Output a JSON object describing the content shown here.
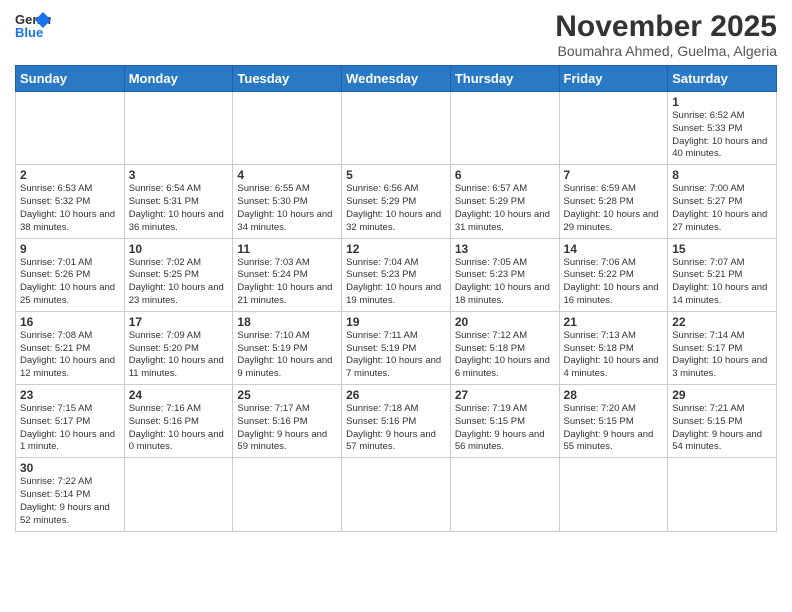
{
  "logo": {
    "text_general": "General",
    "text_blue": "Blue"
  },
  "title": "November 2025",
  "subtitle": "Boumahra Ahmed, Guelma, Algeria",
  "days_of_week": [
    "Sunday",
    "Monday",
    "Tuesday",
    "Wednesday",
    "Thursday",
    "Friday",
    "Saturday"
  ],
  "weeks": [
    [
      {
        "day": "",
        "info": ""
      },
      {
        "day": "",
        "info": ""
      },
      {
        "day": "",
        "info": ""
      },
      {
        "day": "",
        "info": ""
      },
      {
        "day": "",
        "info": ""
      },
      {
        "day": "",
        "info": ""
      },
      {
        "day": "1",
        "info": "Sunrise: 6:52 AM\nSunset: 5:33 PM\nDaylight: 10 hours and 40 minutes."
      }
    ],
    [
      {
        "day": "2",
        "info": "Sunrise: 6:53 AM\nSunset: 5:32 PM\nDaylight: 10 hours and 38 minutes."
      },
      {
        "day": "3",
        "info": "Sunrise: 6:54 AM\nSunset: 5:31 PM\nDaylight: 10 hours and 36 minutes."
      },
      {
        "day": "4",
        "info": "Sunrise: 6:55 AM\nSunset: 5:30 PM\nDaylight: 10 hours and 34 minutes."
      },
      {
        "day": "5",
        "info": "Sunrise: 6:56 AM\nSunset: 5:29 PM\nDaylight: 10 hours and 32 minutes."
      },
      {
        "day": "6",
        "info": "Sunrise: 6:57 AM\nSunset: 5:29 PM\nDaylight: 10 hours and 31 minutes."
      },
      {
        "day": "7",
        "info": "Sunrise: 6:59 AM\nSunset: 5:28 PM\nDaylight: 10 hours and 29 minutes."
      },
      {
        "day": "8",
        "info": "Sunrise: 7:00 AM\nSunset: 5:27 PM\nDaylight: 10 hours and 27 minutes."
      }
    ],
    [
      {
        "day": "9",
        "info": "Sunrise: 7:01 AM\nSunset: 5:26 PM\nDaylight: 10 hours and 25 minutes."
      },
      {
        "day": "10",
        "info": "Sunrise: 7:02 AM\nSunset: 5:25 PM\nDaylight: 10 hours and 23 minutes."
      },
      {
        "day": "11",
        "info": "Sunrise: 7:03 AM\nSunset: 5:24 PM\nDaylight: 10 hours and 21 minutes."
      },
      {
        "day": "12",
        "info": "Sunrise: 7:04 AM\nSunset: 5:23 PM\nDaylight: 10 hours and 19 minutes."
      },
      {
        "day": "13",
        "info": "Sunrise: 7:05 AM\nSunset: 5:23 PM\nDaylight: 10 hours and 18 minutes."
      },
      {
        "day": "14",
        "info": "Sunrise: 7:06 AM\nSunset: 5:22 PM\nDaylight: 10 hours and 16 minutes."
      },
      {
        "day": "15",
        "info": "Sunrise: 7:07 AM\nSunset: 5:21 PM\nDaylight: 10 hours and 14 minutes."
      }
    ],
    [
      {
        "day": "16",
        "info": "Sunrise: 7:08 AM\nSunset: 5:21 PM\nDaylight: 10 hours and 12 minutes."
      },
      {
        "day": "17",
        "info": "Sunrise: 7:09 AM\nSunset: 5:20 PM\nDaylight: 10 hours and 11 minutes."
      },
      {
        "day": "18",
        "info": "Sunrise: 7:10 AM\nSunset: 5:19 PM\nDaylight: 10 hours and 9 minutes."
      },
      {
        "day": "19",
        "info": "Sunrise: 7:11 AM\nSunset: 5:19 PM\nDaylight: 10 hours and 7 minutes."
      },
      {
        "day": "20",
        "info": "Sunrise: 7:12 AM\nSunset: 5:18 PM\nDaylight: 10 hours and 6 minutes."
      },
      {
        "day": "21",
        "info": "Sunrise: 7:13 AM\nSunset: 5:18 PM\nDaylight: 10 hours and 4 minutes."
      },
      {
        "day": "22",
        "info": "Sunrise: 7:14 AM\nSunset: 5:17 PM\nDaylight: 10 hours and 3 minutes."
      }
    ],
    [
      {
        "day": "23",
        "info": "Sunrise: 7:15 AM\nSunset: 5:17 PM\nDaylight: 10 hours and 1 minute."
      },
      {
        "day": "24",
        "info": "Sunrise: 7:16 AM\nSunset: 5:16 PM\nDaylight: 10 hours and 0 minutes."
      },
      {
        "day": "25",
        "info": "Sunrise: 7:17 AM\nSunset: 5:16 PM\nDaylight: 9 hours and 59 minutes."
      },
      {
        "day": "26",
        "info": "Sunrise: 7:18 AM\nSunset: 5:16 PM\nDaylight: 9 hours and 57 minutes."
      },
      {
        "day": "27",
        "info": "Sunrise: 7:19 AM\nSunset: 5:15 PM\nDaylight: 9 hours and 56 minutes."
      },
      {
        "day": "28",
        "info": "Sunrise: 7:20 AM\nSunset: 5:15 PM\nDaylight: 9 hours and 55 minutes."
      },
      {
        "day": "29",
        "info": "Sunrise: 7:21 AM\nSunset: 5:15 PM\nDaylight: 9 hours and 54 minutes."
      }
    ],
    [
      {
        "day": "30",
        "info": "Sunrise: 7:22 AM\nSunset: 5:14 PM\nDaylight: 9 hours and 52 minutes."
      },
      {
        "day": "",
        "info": ""
      },
      {
        "day": "",
        "info": ""
      },
      {
        "day": "",
        "info": ""
      },
      {
        "day": "",
        "info": ""
      },
      {
        "day": "",
        "info": ""
      },
      {
        "day": "",
        "info": ""
      }
    ]
  ]
}
